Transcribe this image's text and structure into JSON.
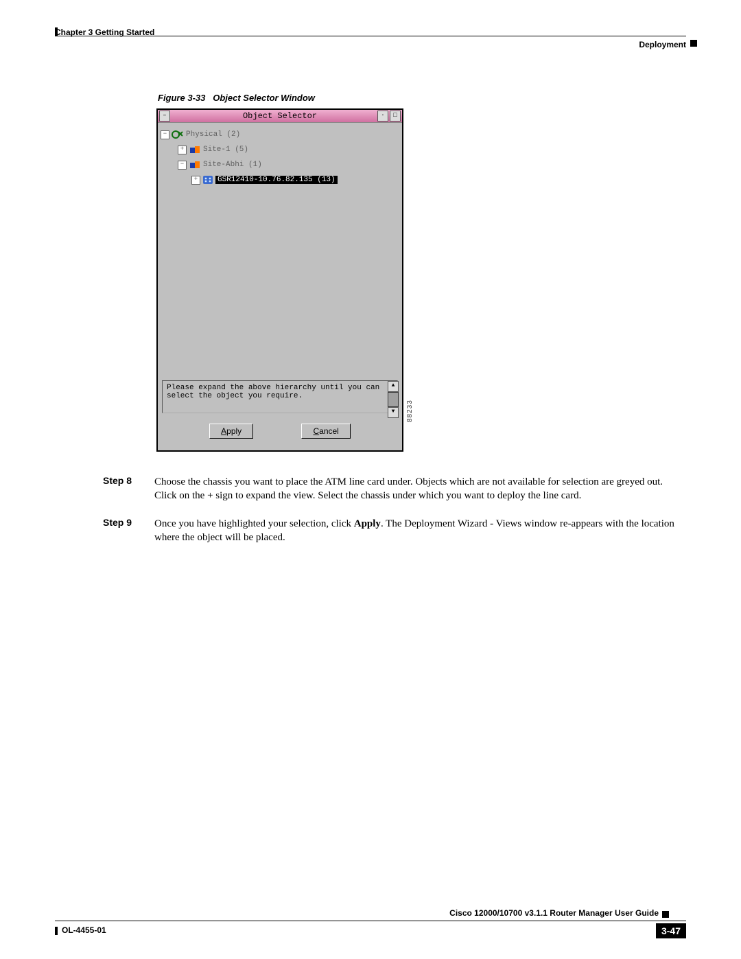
{
  "header": {
    "chapter": "Chapter 3    Getting Started",
    "section": "Deployment"
  },
  "figure": {
    "caption_num": "Figure 3-33",
    "caption_title": "Object Selector Window",
    "ref_id": "88233"
  },
  "selector": {
    "title": "Object Selector",
    "tree": {
      "root": "Physical (2)",
      "site1": "Site-1 (5)",
      "site2": "Site-Abhi (1)",
      "device": "GSR12410-10.76.82.135 (13)"
    },
    "hint": "Please expand the above hierarchy until you can select the object you require.",
    "apply": "Apply",
    "cancel": "Cancel",
    "apply_mn": "A",
    "cancel_mn": "C"
  },
  "steps": {
    "s8_label": "Step 8",
    "s8_body": "Choose the chassis you want to place the ATM line card under. Objects which are not available for selection are greyed out. Click on the + sign to expand the view. Select the chassis under which you want to deploy the line card.",
    "s9_label": "Step 9",
    "s9_body_pre": "Once you have highlighted your selection, click ",
    "s9_body_bold": "Apply",
    "s9_body_post": ". The Deployment Wizard - Views window re-appears with the location where the object will be placed."
  },
  "footer": {
    "title": "Cisco 12000/10700 v3.1.1 Router Manager User Guide",
    "left": "OL-4455-01",
    "page": "3-47"
  }
}
